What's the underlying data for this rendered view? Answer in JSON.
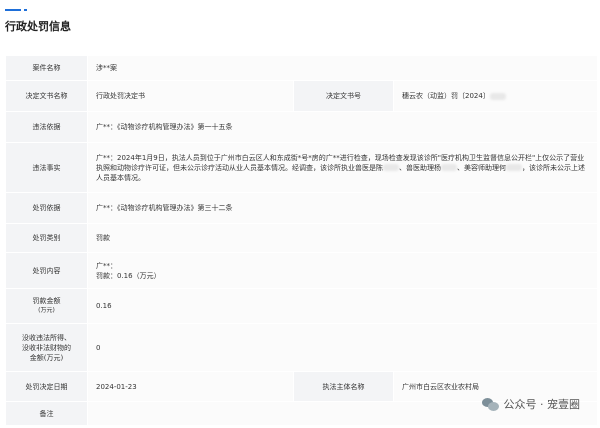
{
  "page": {
    "title": "行政处罚信息"
  },
  "rows": {
    "case_name": {
      "label": "案件名称",
      "value": "涉**案"
    },
    "decision_doc": {
      "label": "决定文书名称",
      "value": "行政处罚决定书",
      "num_label": "决定文书号",
      "num_value": "穗云农（动监）罚〔2024〕"
    },
    "violation_basis": {
      "label": "违法依据",
      "value": "广**：《动物诊疗机构管理办法》第一十五条"
    },
    "violation_facts": {
      "label": "违法事实",
      "value_part1": "广**：2024年1月9日，执法人员到位于广州市白云区人和东成街*号*房的广**进行检查，现场检查发现该诊所\"医疗机构卫生监督信息公开栏\"上仅公示了营业执照和动物诊疗许可证，但未公示诊疗活动从业人员基本情况。经调查，该诊所执业兽医是陈",
      "value_part2": "、兽医助理杨",
      "value_part3": "、美容师助理何",
      "value_part4": "，该诊所未公示上述人员基本情况。"
    },
    "penalty_basis": {
      "label": "处罚依据",
      "value": "广**：《动物诊疗机构管理办法》第三十二条"
    },
    "penalty_type": {
      "label": "处罚类别",
      "value": "罚款"
    },
    "penalty_content": {
      "label": "处罚内容",
      "line1": "广**：",
      "line2": "罚款：0.16（万元）"
    },
    "fine_amount": {
      "label": "罚款金额",
      "label_unit": "(万元)",
      "value": "0.16"
    },
    "confiscation": {
      "label_line1": "没收违法所得、",
      "label_line2": "没收非法财物的",
      "label_line3": "金额(万元)",
      "value": "0"
    },
    "decision_date": {
      "label": "处罚决定日期",
      "value": "2024-01-23",
      "authority_label": "执法主体名称",
      "authority_value": "广州市白云区农业农村局"
    },
    "remarks": {
      "label": "备注",
      "value": ""
    }
  },
  "watermark": {
    "text": "公众号 · 宠壹圈"
  }
}
